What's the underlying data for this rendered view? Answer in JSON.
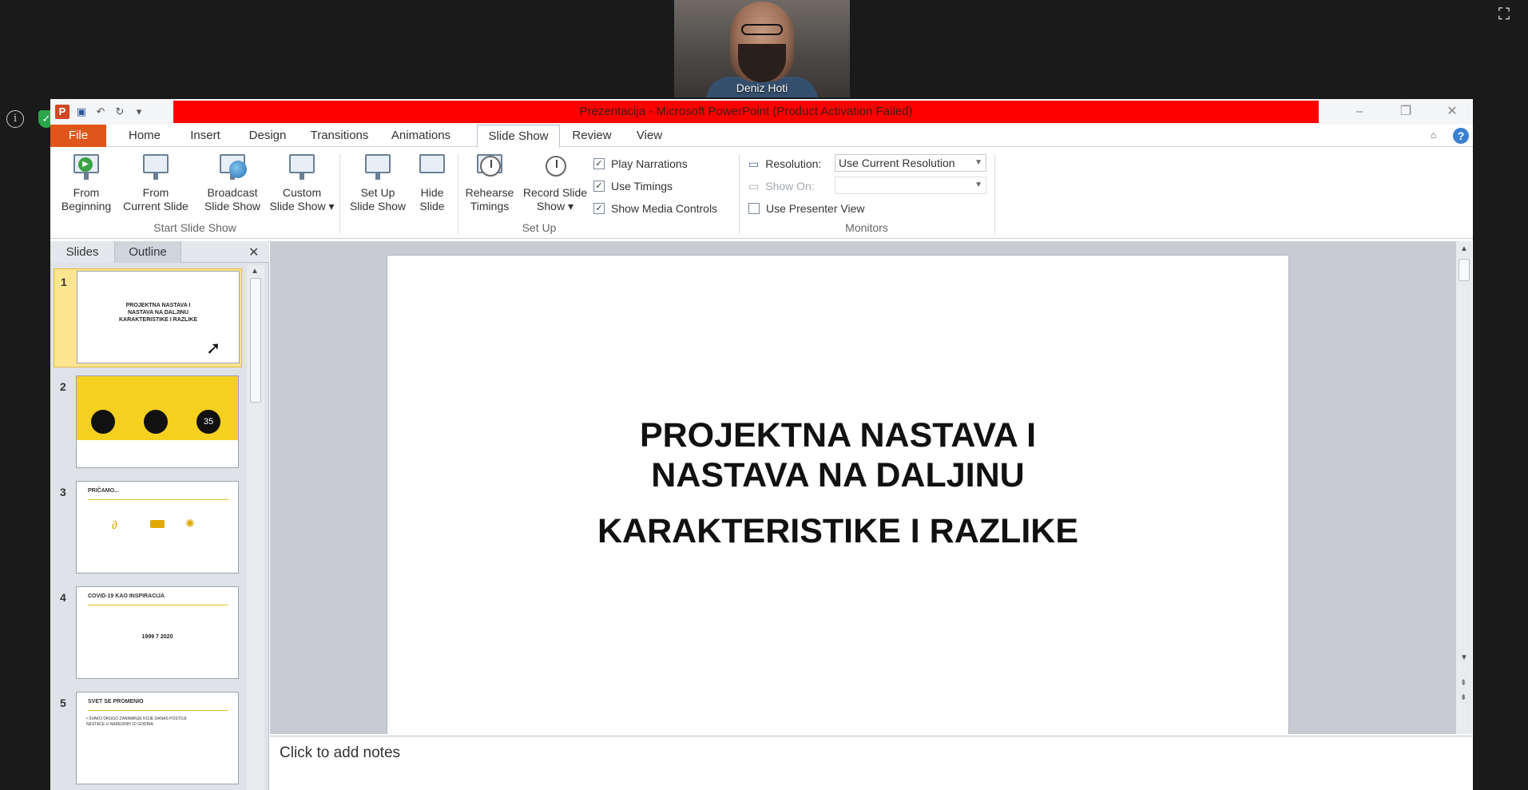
{
  "zoom": {
    "participant_name": "Deniz Hoti",
    "fullscreen_icon": "fullscreen-icon",
    "info_icon": "info-icon",
    "security_icon": "shield-check-icon"
  },
  "window": {
    "title": "Prezentacija  -  Microsoft PowerPoint (Product Activation Failed)",
    "title_bar_color": "#ff0000",
    "controls": [
      "–",
      "❐",
      "✕"
    ]
  },
  "quick_access": {
    "save_icon": "save-icon",
    "undo_icon": "undo-icon",
    "redo_icon": "redo-icon",
    "customize_icon": "chevron-down-icon"
  },
  "tabs": [
    "File",
    "Home",
    "Insert",
    "Design",
    "Transitions",
    "Animations",
    "Slide Show",
    "Review",
    "View"
  ],
  "ribbon": {
    "start_group": {
      "label": "Start Slide Show",
      "from_beginning": [
        "From",
        "Beginning"
      ],
      "from_current": [
        "From",
        "Current Slide"
      ],
      "broadcast": [
        "Broadcast",
        "Slide Show"
      ],
      "custom": [
        "Custom",
        "Slide Show ▾"
      ]
    },
    "setup_group": {
      "label": "Set Up",
      "setup": [
        "Set Up",
        "Slide Show"
      ],
      "hide": [
        "Hide",
        "Slide"
      ],
      "rehearse": [
        "Rehearse",
        "Timings"
      ],
      "record": [
        "Record Slide",
        "Show ▾"
      ],
      "play_narrations": "Play Narrations",
      "use_timings": "Use Timings",
      "show_media_controls": "Show Media Controls"
    },
    "monitors_group": {
      "label": "Monitors",
      "resolution_label": "Resolution:",
      "resolution_value": "Use Current Resolution",
      "show_on_label": "Show On:",
      "show_on_value": "",
      "use_presenter_view": "Use Presenter View"
    }
  },
  "pane": {
    "tab_slides": "Slides",
    "tab_outline": "Outline",
    "close": "✕"
  },
  "slides": [
    {
      "num": "1",
      "title_lines": [
        "PROJEKTNA   NASTAVA  I",
        "NASTAVA  NA  DALJINU",
        "KARAKTERISTIKE    I  RAZLIKE"
      ]
    },
    {
      "num": "2",
      "badge": "35"
    },
    {
      "num": "3",
      "heading": "PRIČAMO..."
    },
    {
      "num": "4",
      "heading": "COVID-19   KAO  INSPIRACIJA",
      "years": "1999   7   2020"
    },
    {
      "num": "5",
      "heading": "SVET  SE  PROMENIO",
      "bullet": "• SVAKO  DRUGO  ZANIMANJE    KOJE  DANAS  POSTOJI  NESTAĆE  U  NAREDNIH    10 GODINA"
    }
  ],
  "current_slide": {
    "line1": "PROJEKTNA NASTAVA I",
    "line2": "NASTAVA NA DALJINU",
    "line3": "KARAKTERISTIKE I RAZLIKE"
  },
  "notes_placeholder": "Click to add notes"
}
